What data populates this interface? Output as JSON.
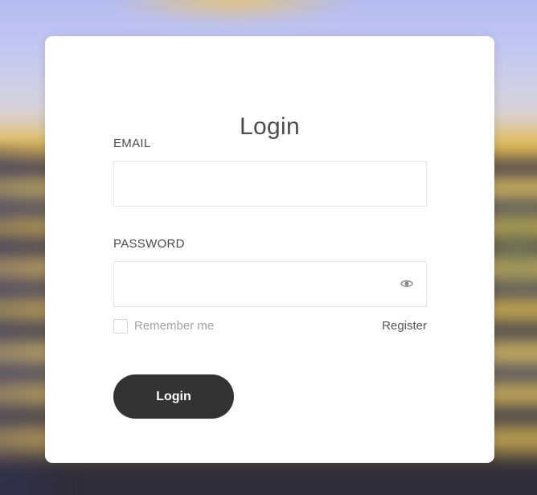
{
  "form": {
    "title": "Login",
    "email_label": "EMAIL",
    "email_value": "",
    "password_label": "PASSWORD",
    "password_value": "",
    "password_toggle_icon": "eye-icon",
    "remember_label": "Remember me",
    "remember_checked": false,
    "register_label": "Register",
    "login_button_label": "Login"
  },
  "colors": {
    "button_background": "#333333",
    "button_text": "#ffffff",
    "card_background": "#ffffff",
    "title_text": "#4d4d4d"
  }
}
